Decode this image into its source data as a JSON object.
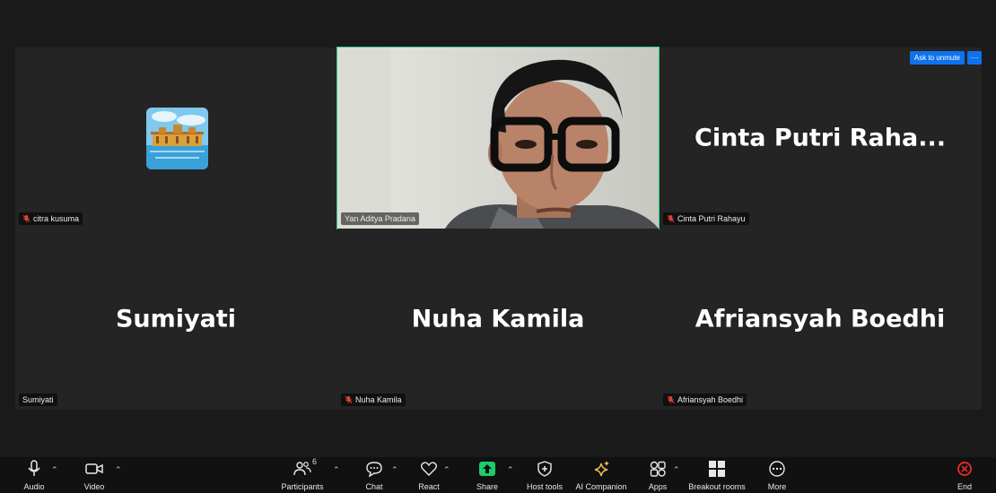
{
  "gallery": {
    "ask_to_unmute": "Ask to unmute",
    "more_options": "···",
    "tiles": [
      {
        "display_name": "",
        "name_tag": "citra kusuma",
        "muted": true,
        "type": "avatar"
      },
      {
        "display_name": "",
        "name_tag": "Yan Aditya Pradana",
        "muted": false,
        "type": "video"
      },
      {
        "display_name": "Cinta Putri Raha...",
        "name_tag": "Cinta Putri Rahayu",
        "muted": true,
        "type": "name"
      },
      {
        "display_name": "Sumiyati",
        "name_tag": "Sumiyati",
        "muted": false,
        "type": "name"
      },
      {
        "display_name": "Nuha Kamila",
        "name_tag": "Nuha Kamila",
        "muted": true,
        "type": "name"
      },
      {
        "display_name": "Afriansyah Boedhi",
        "name_tag": "Afriansyah Boedhi",
        "muted": true,
        "type": "name"
      }
    ]
  },
  "toolbar": {
    "audio": "Audio",
    "video": "Video",
    "participants": "Participants",
    "participants_count": "6",
    "chat": "Chat",
    "react": "React",
    "share": "Share",
    "host_tools": "Host tools",
    "ai_companion": "AI Companion",
    "apps": "Apps",
    "breakout_rooms": "Breakout rooms",
    "more": "More",
    "end": "End"
  },
  "colors": {
    "accent_blue": "#0e72ed",
    "active_speaker": "#2fd38a",
    "share_green": "#1ecb6b",
    "end_red": "#e02828",
    "mute_red": "#e0413a"
  }
}
